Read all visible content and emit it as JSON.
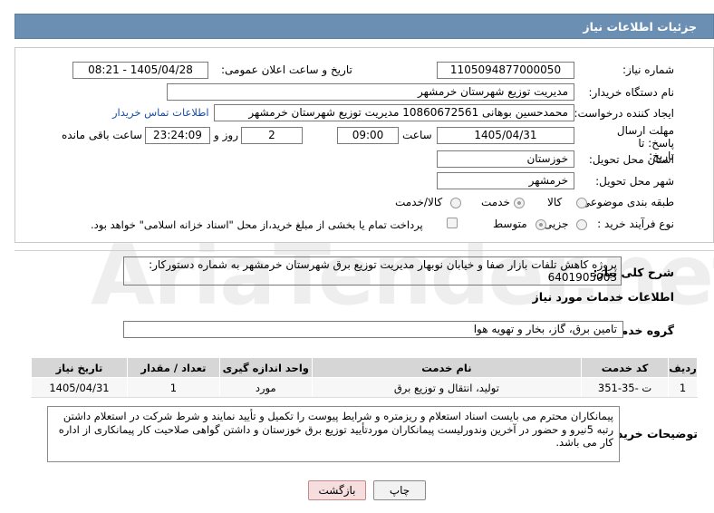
{
  "header": {
    "title": "جزئیات اطلاعات نیاز"
  },
  "form": {
    "need_number": {
      "label": "شماره نیاز:",
      "value": "1105094877000050"
    },
    "announce_datetime": {
      "label": "تاریخ و ساعت اعلان عمومی:",
      "value": "1405/04/28 - 08:21"
    },
    "buyer_org": {
      "label": "نام دستگاه خریدار:",
      "value": "مدیریت توزیع شهرستان خرمشهر"
    },
    "requester": {
      "label": "ایجاد کننده درخواست:",
      "value": "محمدحسین بوهانی 10860672561 مدیریت توزیع شهرستان خرمشهر",
      "contact_link": "اطلاعات تماس خریدار"
    },
    "deadline": {
      "label": "مهلت ارسال پاسخ: تا تاریخ:",
      "date": "1405/04/31",
      "time_label": "ساعت",
      "time": "09:00",
      "days": "2",
      "days_label": "روز و",
      "remaining": "23:24:09",
      "remaining_label": "ساعت باقی مانده"
    },
    "province": {
      "label": "استان محل تحویل:",
      "value": "خوزستان"
    },
    "city": {
      "label": "شهر محل تحویل:",
      "value": "خرمشهر"
    },
    "category": {
      "label": "طبقه بندی موضوعی:",
      "options": [
        "کالا",
        "خدمت",
        "کالا/خدمت"
      ],
      "selected": "خدمت"
    },
    "process_type": {
      "label": "نوع فرآیند خرید :",
      "options": [
        "جزیی",
        "متوسط"
      ],
      "selected": "متوسط",
      "payment_note": "پرداخت تمام یا بخشی از مبلغ خرید،از محل \"اسناد خزانه اسلامی\" خواهد بود."
    }
  },
  "summary": {
    "label": "شرح کلی نیاز:",
    "value": "پروژه کاهش تلفات بازار صفا و خیابان نوبهار مدیریت توزیع برق شهرستان خرمشهر به شماره دستورکار: 6401905003"
  },
  "services": {
    "section_title": "اطلاعات خدمات مورد نیاز",
    "group_label": "گروه خدمت:",
    "group_value": "تامین برق، گاز، بخار و تهویه هوا",
    "columns": [
      "ردیف",
      "کد خدمت",
      "نام خدمت",
      "واحد اندازه گیری",
      "تعداد / مقدار",
      "تاریخ نیاز"
    ],
    "rows": [
      [
        "1",
        "ت -35-351",
        "تولید، انتقال و توزیع برق",
        "مورد",
        "1",
        "1405/04/31"
      ]
    ]
  },
  "buyer_notes": {
    "label": "توضیحات خریدار:",
    "value": "پیمانکاران محترم می بایست اسناد استعلام و ریزمتره و شرایط پیوست را تکمیل و تأیید نمایند و شرط شرکت در استعلام داشتن رتبه 5نیرو و حضور در آخرین وندورلیست پیمانکاران موردتأیید توزیع برق خوزستان و داشتن گواهی صلاحیت کار پیمانکاری از اداره کار می باشد."
  },
  "buttons": {
    "print": "چاپ",
    "back": "بازگشت"
  },
  "watermark": "AriaTender.net",
  "colors": {
    "header_bg": "#6a8fb3",
    "link": "#1a4fa0",
    "back_button_bg": "#f7dede"
  }
}
